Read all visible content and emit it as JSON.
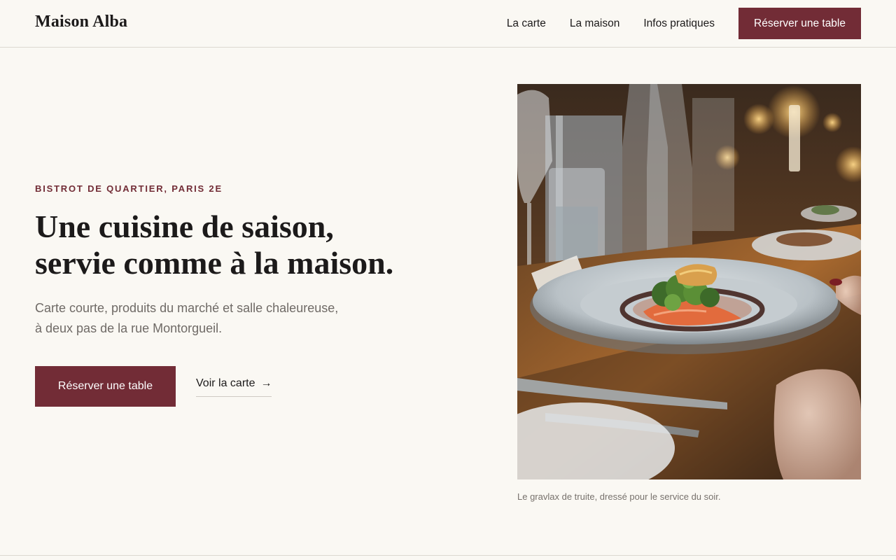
{
  "header": {
    "brand": "Maison Alba",
    "nav": [
      {
        "label": "La carte"
      },
      {
        "label": "La maison"
      },
      {
        "label": "Infos pratiques"
      }
    ],
    "cta_label": "Réserver une table"
  },
  "hero": {
    "eyebrow": "BISTROT DE QUARTIER, PARIS 2E",
    "title_lines": [
      "Une cuisine de saison,",
      "servie comme à la maison."
    ],
    "lead_lines": [
      "Carte courte, produits du marché et salle chaleureuse,",
      "à deux pas de la rue Montorgueil."
    ],
    "primary_cta": "Réserver une table",
    "secondary_link": "Voir la carte",
    "secondary_icon": "arrow-right-icon"
  },
  "photo": {
    "caption": "Le gravlax de truite, dressé pour le service du soir."
  },
  "colors": {
    "accent": "#722c36",
    "background": "#faf8f3",
    "text": "#1c1a1a",
    "muted": "#6f6a66"
  }
}
